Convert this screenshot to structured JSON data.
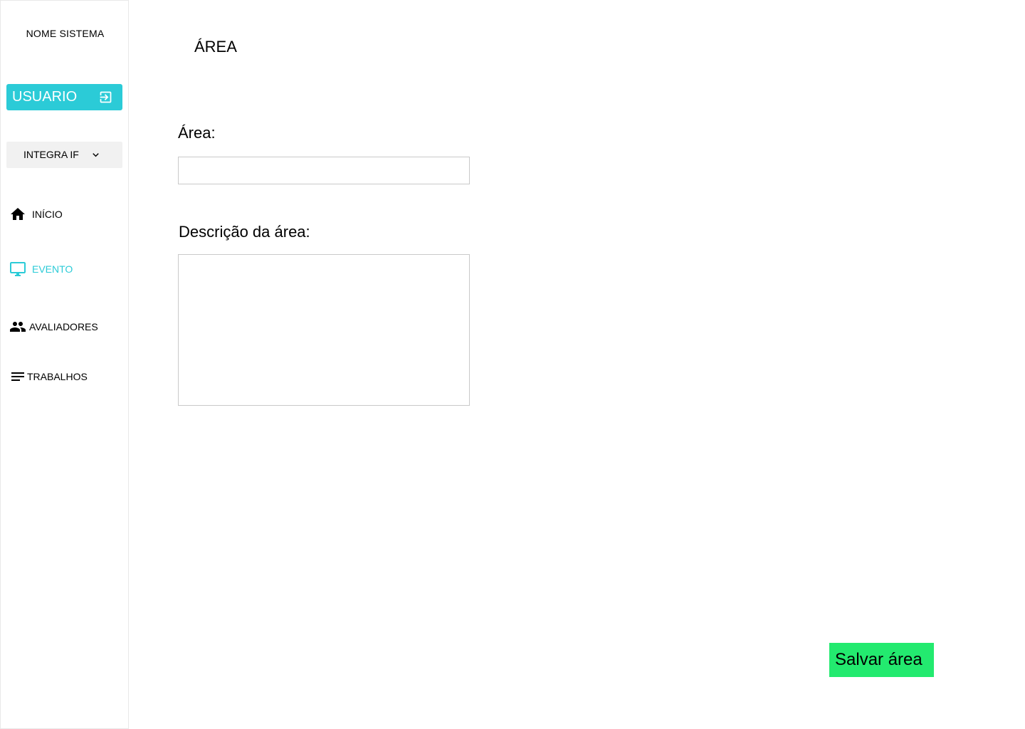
{
  "sidebar": {
    "system_name": "NOME SISTEMA",
    "user_button": {
      "label": "USUARIO",
      "icon": "logout-icon"
    },
    "event_select": {
      "value": "INTEGRA IF",
      "icon": "chevron-down-icon"
    },
    "nav": {
      "inicio": {
        "label": "INÍCIO",
        "icon": "home-icon"
      },
      "evento": {
        "label": "EVENTO",
        "icon": "monitor-icon",
        "active": true
      },
      "avaliadores": {
        "label": "AVALIADORES",
        "icon": "people-icon"
      },
      "trabalhos": {
        "label": "TRABALHOS",
        "icon": "list-icon"
      }
    }
  },
  "main": {
    "title": "ÁREA",
    "area_field": {
      "label": "Área:",
      "value": ""
    },
    "description_field": {
      "label": "Descrição da área:",
      "value": ""
    },
    "save_button": {
      "label": "Salvar área"
    }
  },
  "colors": {
    "accent": "#2bcbd7",
    "save_button": "#23ea6f",
    "select_bg": "#f1f1f1"
  }
}
